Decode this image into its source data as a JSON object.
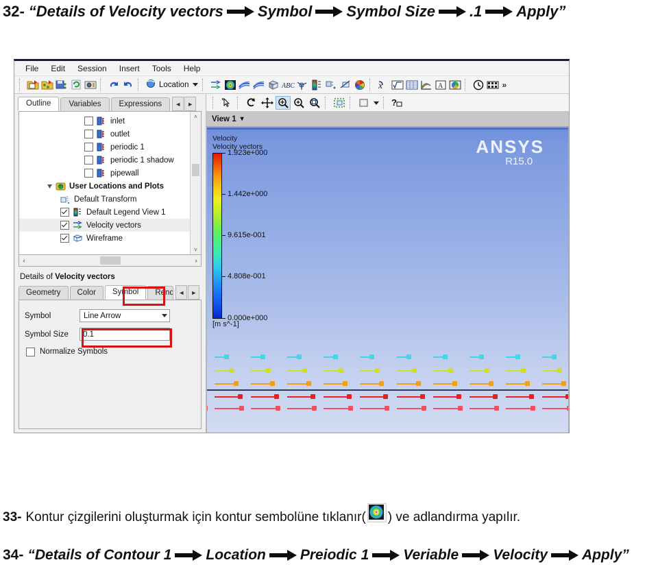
{
  "instructions": {
    "line32": {
      "number": "32-",
      "segments": [
        "“Details of Velocity vectors",
        "Symbol",
        "Symbol Size",
        ".1",
        "Apply”"
      ]
    },
    "line33": {
      "number": "33-",
      "text_before": "Kontur çizgilerini oluşturmak için kontur sembolüne tıklanır(",
      "icon": "contour-icon",
      "text_after": ") ve adlandırma yapılır."
    },
    "line34": {
      "number": "34-",
      "segments": [
        "“Details of Contour 1",
        "Location",
        "Preiodic 1",
        "Veriable",
        "Velocity",
        "Apply”"
      ]
    }
  },
  "app": {
    "menu": [
      "File",
      "Edit",
      "Session",
      "Insert",
      "Tools",
      "Help"
    ],
    "toolbar": {
      "icons": [
        "new-case-icon",
        "open-case-icon",
        "save-state-icon",
        "refresh-icon",
        "snapshot-icon"
      ],
      "undo": "undo-icon",
      "redo": "redo-icon",
      "location_label": "Location",
      "location_icon": "location-icon",
      "post_icons": [
        "vector-icon",
        "contour-icon",
        "streamline-icon",
        "particle-track-icon",
        "volume-render-icon",
        "text-label-icon",
        "coordinate-frame-icon",
        "legend-icon",
        "instancing-icon",
        "clip-plane-icon",
        "color-map-icon"
      ],
      "calc_icons": [
        "function-calculator-icon",
        "expression-icon",
        "table-icon",
        "chart-icon",
        "comment-icon",
        "report-icon"
      ],
      "timestep_icons": [
        "timestep-icon",
        "animation-icon"
      ],
      "overflow": "»"
    }
  },
  "outline": {
    "tabs": [
      {
        "label": "Outline",
        "active": true
      },
      {
        "label": "Variables",
        "active": false
      },
      {
        "label": "Expressions",
        "active": false
      }
    ],
    "nav_prev": "◄",
    "nav_next": "►",
    "tree": [
      {
        "label": "inlet",
        "icon": "boundary-icon",
        "checked": false,
        "indent": 1,
        "bold": false,
        "selected": false
      },
      {
        "label": "outlet",
        "icon": "boundary-icon",
        "checked": false,
        "indent": 1,
        "bold": false,
        "selected": false
      },
      {
        "label": "periodic 1",
        "icon": "boundary-icon",
        "checked": false,
        "indent": 1,
        "bold": false,
        "selected": false
      },
      {
        "label": "periodic 1 shadow",
        "icon": "boundary-icon",
        "checked": false,
        "indent": 1,
        "bold": false,
        "selected": false
      },
      {
        "label": "pipewall",
        "icon": "boundary-icon",
        "checked": false,
        "indent": 1,
        "bold": false,
        "selected": false
      },
      {
        "label": "User Locations and Plots",
        "icon": "user-locations-icon",
        "checked": null,
        "indent": 2,
        "bold": true,
        "selected": false
      },
      {
        "label": "Default Transform",
        "icon": "transform-icon",
        "checked": null,
        "indent": 3,
        "bold": false,
        "selected": false
      },
      {
        "label": "Default Legend View 1",
        "icon": "legend-icon",
        "checked": true,
        "indent": 3,
        "bold": false,
        "selected": false
      },
      {
        "label": "Velocity vectors",
        "icon": "vector-icon",
        "checked": true,
        "indent": 3,
        "bold": false,
        "selected": true
      },
      {
        "label": "Wireframe",
        "icon": "wireframe-icon",
        "checked": true,
        "indent": 3,
        "bold": false,
        "selected": false
      }
    ],
    "scroll_up": "˄",
    "scroll_down": "˅",
    "scroll_left": "‹",
    "scroll_right": "›"
  },
  "details": {
    "header_prefix": "Details of ",
    "header_object": "Velocity vectors",
    "tabs": [
      {
        "label": "Geometry",
        "active": false
      },
      {
        "label": "Color",
        "active": false
      },
      {
        "label": "Symbol",
        "active": true
      },
      {
        "label": "Rend",
        "active": false
      }
    ],
    "nav_prev": "◄",
    "nav_next": "►",
    "fields": {
      "symbol_label": "Symbol",
      "symbol_value": "Line Arrow",
      "symbol_size_label": "Symbol Size",
      "symbol_size_value": "0.1",
      "normalize_label": "Normalize Symbols",
      "normalize_checked": false
    }
  },
  "viewer": {
    "toolbar_icons": [
      "pick-icon",
      "rotate-icon",
      "pan-icon",
      "zoom-box-icon",
      "zoom-in-icon",
      "zoom-fit-icon",
      "fit-view-icon",
      "background-color-icon",
      "help-context-icon"
    ],
    "active_tool": "zoom-box-icon",
    "view_label": "View 1",
    "view_caret": "▾",
    "logo": {
      "brand": "ANSYS",
      "release": "R15.0"
    }
  },
  "chart_data": {
    "type": "heatmap",
    "title": "Velocity",
    "subtitle": "Velocity vectors",
    "units": "[m s^-1]",
    "colormap": "rainbow",
    "legend_position": "left",
    "ticks": [
      {
        "value": 1.923,
        "label": "1.923e+000",
        "pos": 1.0
      },
      {
        "value": 1.442,
        "label": "1.442e+000",
        "pos": 0.75
      },
      {
        "value": 0.9615,
        "label": "9.615e-001",
        "pos": 0.5
      },
      {
        "value": 0.4808,
        "label": "4.808e-001",
        "pos": 0.25
      },
      {
        "value": 0.0,
        "label": "0.000e+000",
        "pos": 0.0
      }
    ],
    "range": [
      0.0,
      1.923
    ],
    "vector_rows": [
      {
        "y_frac": 0.12,
        "speed": 0.48,
        "color": "#3fd8e8",
        "length": 14
      },
      {
        "y_frac": 0.27,
        "speed": 1.3,
        "color": "#cfe022",
        "length": 22
      },
      {
        "y_frac": 0.42,
        "speed": 1.6,
        "color": "#f0a018",
        "length": 28
      },
      {
        "y_frac": 0.57,
        "speed": 1.85,
        "color": "#e82020",
        "length": 34
      },
      {
        "y_frac": 0.7,
        "speed": 1.92,
        "color": "#f05060",
        "length": 36
      }
    ],
    "columns": 10
  }
}
